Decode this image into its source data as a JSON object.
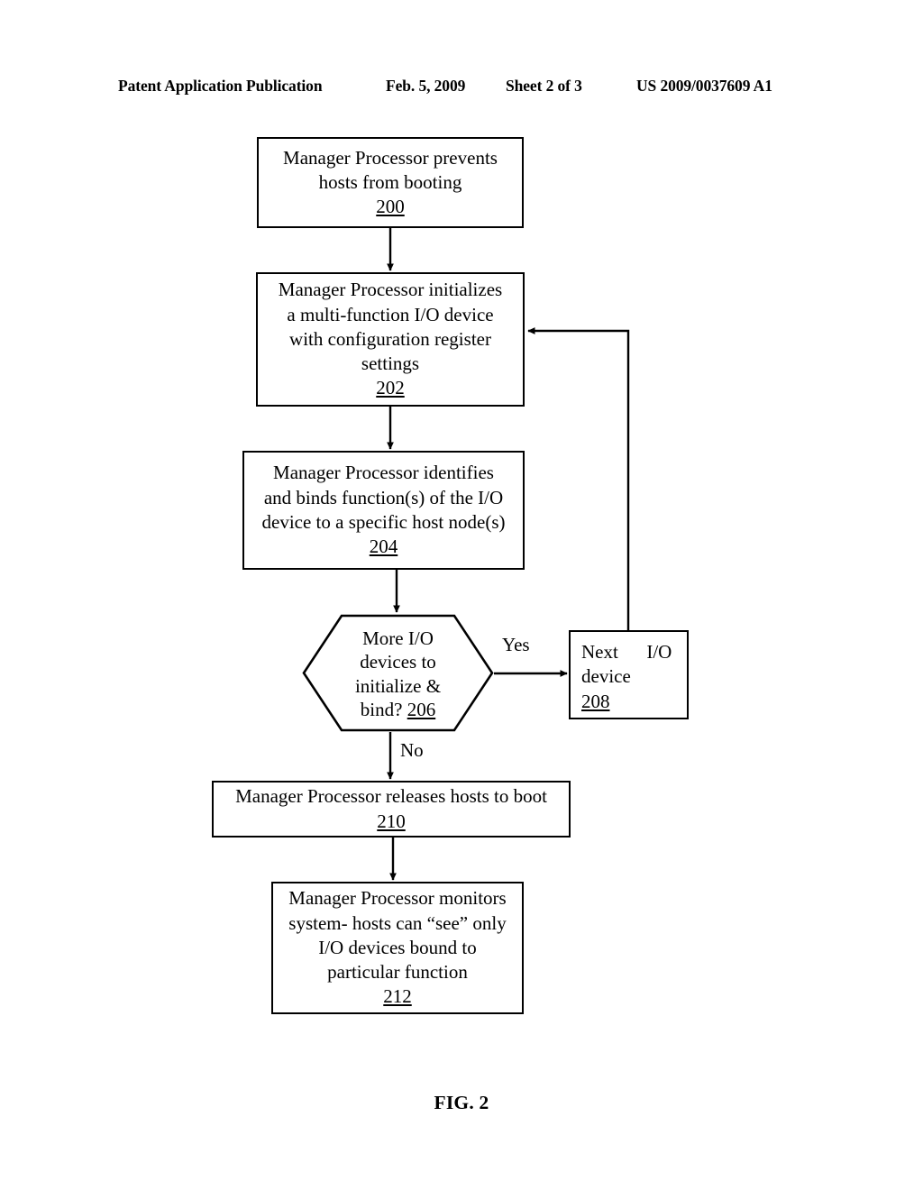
{
  "header": {
    "publication": "Patent Application Publication",
    "date": "Feb. 5, 2009",
    "sheet": "Sheet 2 of 3",
    "patent_number": "US 2009/0037609 A1"
  },
  "figure": {
    "caption": "FIG. 2"
  },
  "colors": {
    "stroke": "#000000",
    "background": "#ffffff",
    "text": "#000000"
  },
  "flowchart": {
    "type": "flowchart",
    "nodes": [
      {
        "id": "200",
        "shape": "rectangle",
        "lines": [
          "Manager Processor prevents",
          "hosts from booting"
        ],
        "ref": "200"
      },
      {
        "id": "202",
        "shape": "rectangle",
        "lines": [
          "Manager Processor initializes",
          "a multi-function I/O device",
          "with configuration register",
          "settings"
        ],
        "ref": "202"
      },
      {
        "id": "204",
        "shape": "rectangle",
        "lines": [
          "Manager Processor identifies",
          "and binds function(s) of the I/O",
          "device to a specific host node(s)"
        ],
        "ref": "204"
      },
      {
        "id": "206",
        "shape": "hexagon",
        "lines": [
          "More I/O",
          "devices to",
          "initialize &",
          "bind? 206"
        ],
        "ref": "206"
      },
      {
        "id": "208",
        "shape": "rectangle",
        "lines": [
          "Next      I/O",
          "device"
        ],
        "ref": "208"
      },
      {
        "id": "210",
        "shape": "rectangle",
        "lines": [
          "Manager Processor releases hosts to boot"
        ],
        "ref": "210"
      },
      {
        "id": "212",
        "shape": "rectangle",
        "lines": [
          "Manager Processor monitors",
          "system- hosts can “see” only",
          "I/O devices bound to",
          "particular function"
        ],
        "ref": "212"
      }
    ],
    "edges": [
      {
        "from": "200",
        "to": "202",
        "label": ""
      },
      {
        "from": "202",
        "to": "204",
        "label": ""
      },
      {
        "from": "204",
        "to": "206",
        "label": ""
      },
      {
        "from": "206",
        "to": "208",
        "label": "Yes"
      },
      {
        "from": "206",
        "to": "210",
        "label": "No"
      },
      {
        "from": "208",
        "to": "202",
        "label": ""
      },
      {
        "from": "210",
        "to": "212",
        "label": ""
      }
    ],
    "edge_labels": {
      "yes": "Yes",
      "no": "No"
    }
  }
}
